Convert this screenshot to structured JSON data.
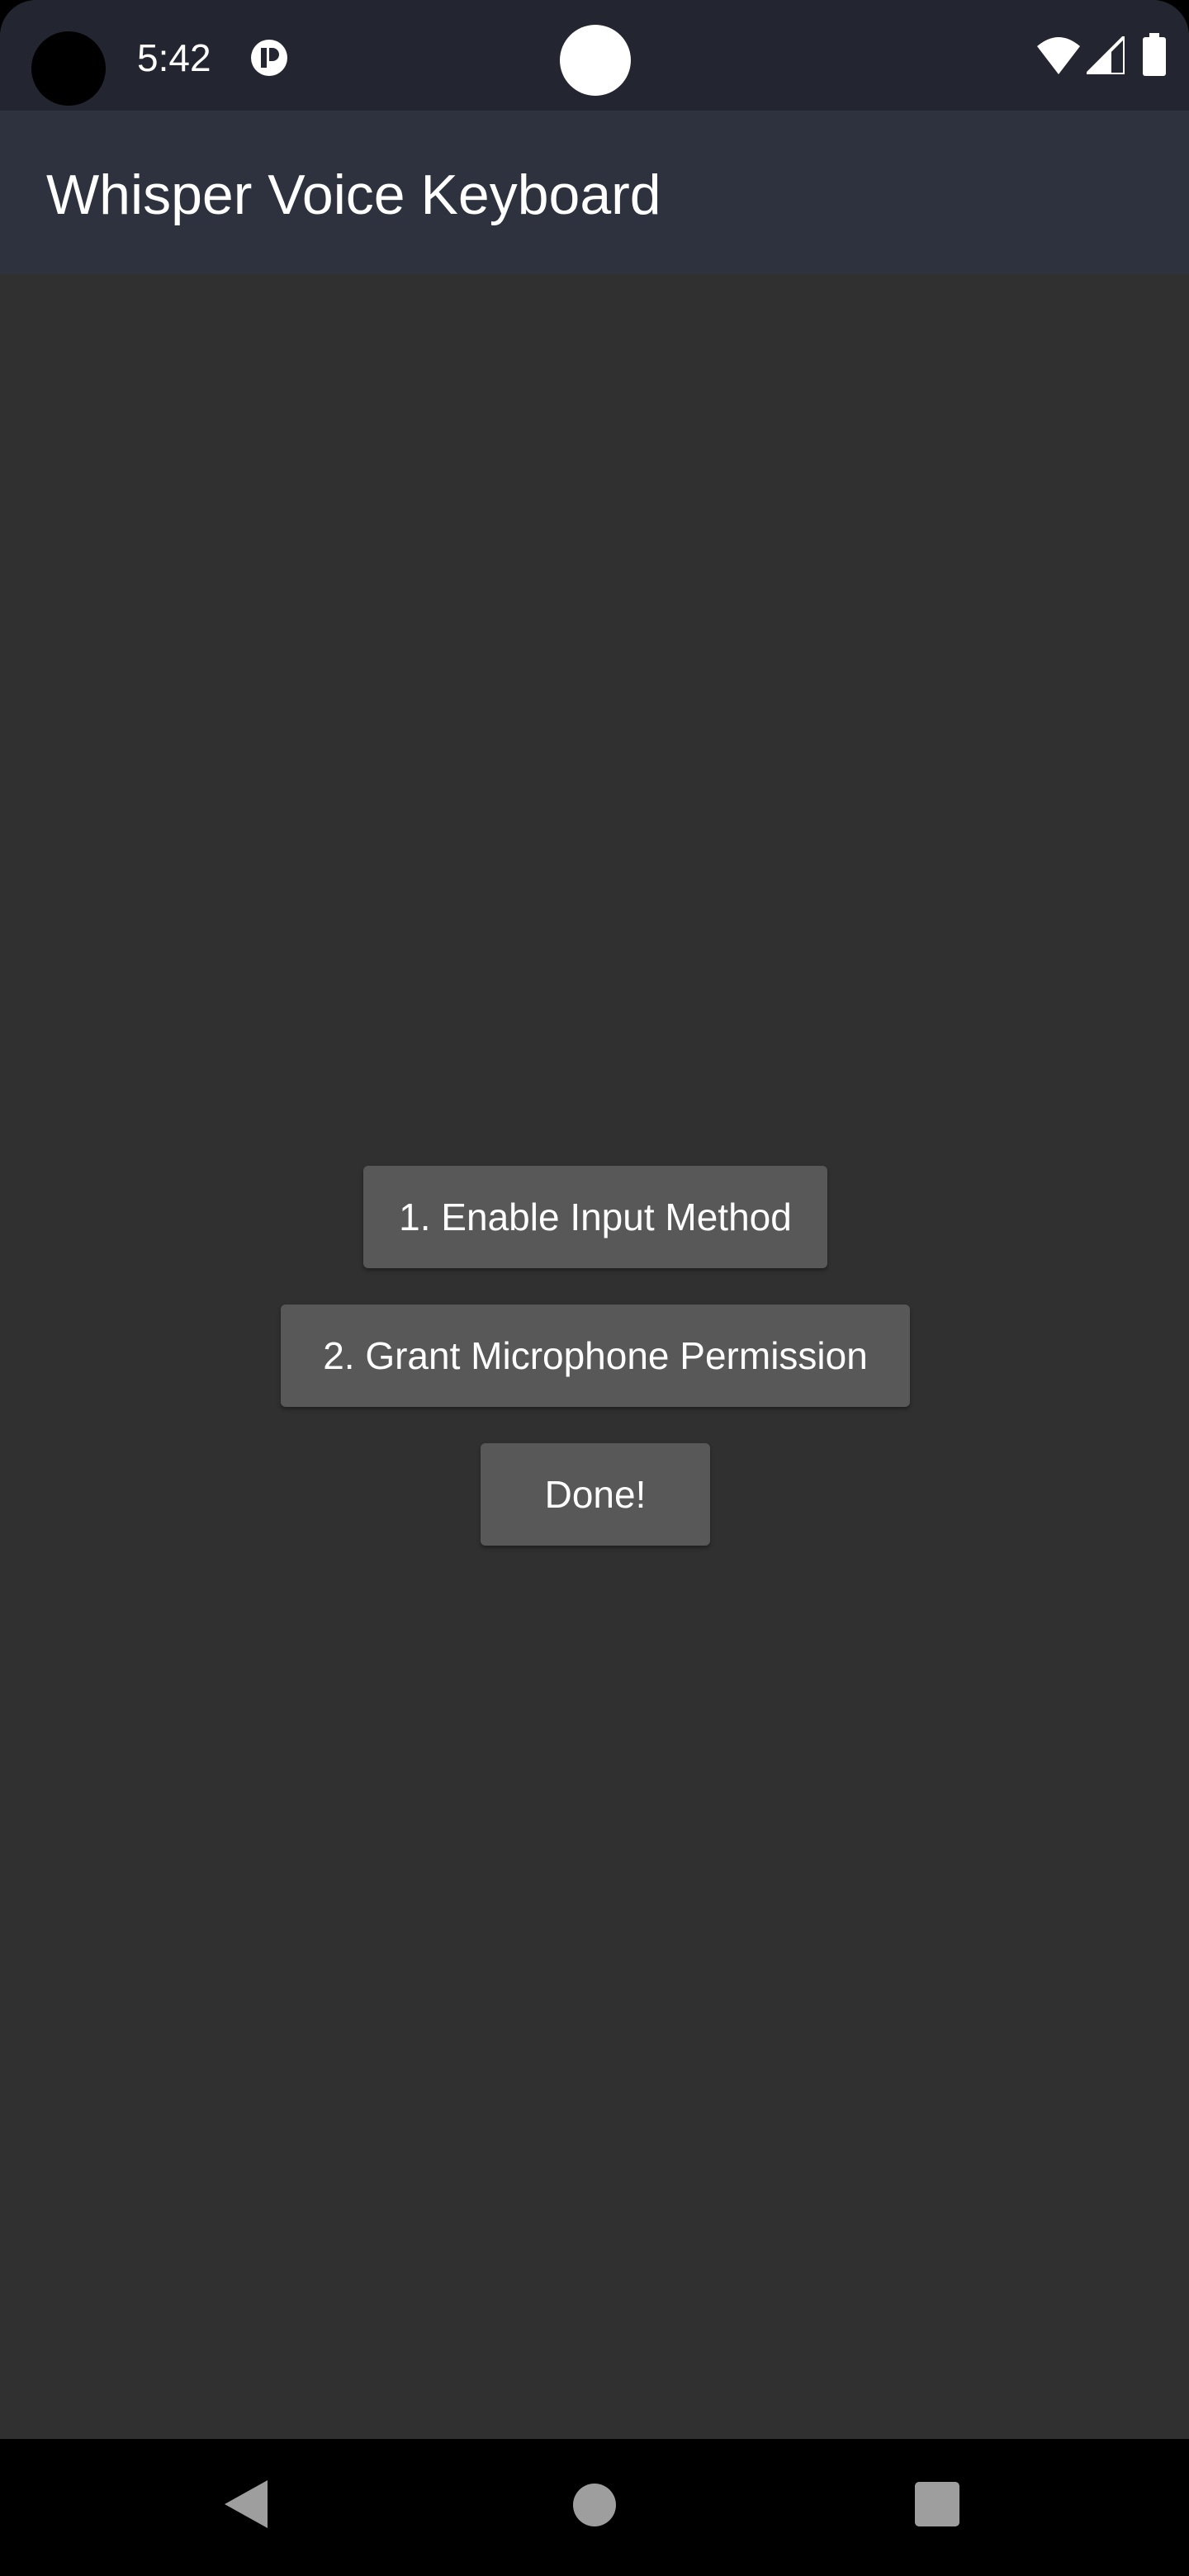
{
  "status_bar": {
    "time": "5:42",
    "icons": [
      "app-notification-icon",
      "wifi-icon",
      "cellular-signal-icon",
      "battery-icon"
    ]
  },
  "app_bar": {
    "title": "Whisper Voice Keyboard"
  },
  "main": {
    "enable_input_method_label": "1. Enable Input Method",
    "grant_microphone_label": "2. Grant Microphone Permission",
    "done_label": "Done!"
  },
  "nav_bar": {
    "icons": [
      "back-icon",
      "home-icon",
      "recents-icon"
    ]
  },
  "colors": {
    "status_bar_bg": "#232630",
    "app_bar_bg": "#2e323e",
    "screen_bg": "#303030",
    "button_bg": "#585858",
    "text": "#ffffff"
  }
}
